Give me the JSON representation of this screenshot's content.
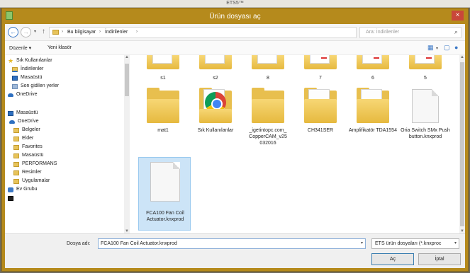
{
  "app": {
    "title": "ETS5™"
  },
  "dialog": {
    "title": "Ürün dosyası aç",
    "close_label": "×"
  },
  "address": {
    "back_label": "←",
    "forward_label": "→",
    "up_label": "↑",
    "crumbs": [
      "Bu bilgisayar",
      "İndirilenler"
    ],
    "separator": "›",
    "refresh_label": "↻"
  },
  "search": {
    "placeholder": "Ara: İndirilenler",
    "icon_label": "⌕"
  },
  "toolbar": {
    "organize_label": "Düzenle ▾",
    "new_folder_label": "Yeni klasör"
  },
  "nav": {
    "items": [
      {
        "label": "Sık Kullanılanlar",
        "icon": "star-icon"
      },
      {
        "label": "İndirilenler",
        "icon": "downloads-icon"
      },
      {
        "label": "Masaüstü",
        "icon": "desktop-icon"
      },
      {
        "label": "Son gidilen yerler",
        "icon": "recent-places-icon"
      },
      {
        "label": "OneDrive",
        "icon": "onedrive-icon"
      },
      {
        "label": "Masaüstü",
        "icon": "desktop-icon"
      },
      {
        "label": "OneDrive",
        "icon": "onedrive-icon"
      },
      {
        "label": "Belgeler",
        "icon": "folder-icon"
      },
      {
        "label": "Elder",
        "icon": "folder-icon"
      },
      {
        "label": "Favorites",
        "icon": "folder-icon"
      },
      {
        "label": "Masaüstü",
        "icon": "folder-icon"
      },
      {
        "label": "PERFORMANS",
        "icon": "folder-icon"
      },
      {
        "label": "Resimler",
        "icon": "folder-icon"
      },
      {
        "label": "Uygulamalar",
        "icon": "folder-icon"
      },
      {
        "label": "Ev Grubu",
        "icon": "homegroup-icon"
      }
    ]
  },
  "files": {
    "row1": [
      {
        "label": "s1"
      },
      {
        "label": "s2"
      },
      {
        "label": "8"
      },
      {
        "label": "7"
      },
      {
        "label": "6"
      },
      {
        "label": "5"
      }
    ],
    "row2": [
      {
        "label": "mat1",
        "kind": "folder"
      },
      {
        "label": "Sık Kullanılanlar",
        "kind": "folder-chrome"
      },
      {
        "label": "_igetintopc.com_ CopperCAM_v25 032016",
        "kind": "folder"
      },
      {
        "label": "CH341SER",
        "kind": "folder"
      },
      {
        "label": "Amplifikatör TDA1554",
        "kind": "folder"
      },
      {
        "label": "Oria Switch SMx Push button.knxprod",
        "kind": "file"
      }
    ],
    "row3": [
      {
        "label": "FCA100 Fan Coil Actuator.knxprod",
        "kind": "file",
        "selected": true
      }
    ]
  },
  "footer": {
    "filename_label": "Dosya adı:",
    "filename_value": "FCA100 Fan Coil Actuator.knxprod",
    "filetype_value": "ETS ürün dosyaları (*.knxproc",
    "open_label": "Aç",
    "cancel_label": "İptal"
  }
}
